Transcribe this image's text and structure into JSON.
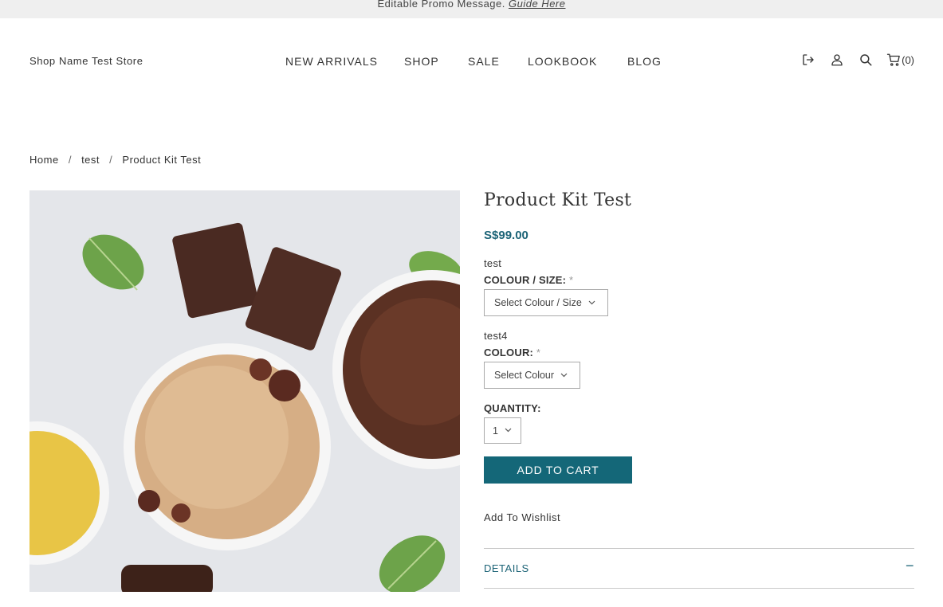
{
  "promo": {
    "text": "Editable Promo Message.",
    "link": "Guide Here"
  },
  "header": {
    "store_name": "Shop Name Test Store",
    "nav": [
      "NEW ARRIVALS",
      "SHOP",
      "SALE",
      "LOOKBOOK",
      "BLOG"
    ],
    "icons": [
      "logout-icon",
      "user-icon",
      "search-icon",
      "cart-icon"
    ],
    "cart_count": "(0)"
  },
  "breadcrumb": {
    "items": [
      "Home",
      "test",
      "Product Kit Test"
    ],
    "separator": "/"
  },
  "product": {
    "title": "Product Kit Test",
    "price": "S$99.00",
    "options": [
      {
        "name": "test",
        "label": "COLOUR / SIZE:",
        "required": "*",
        "placeholder": "Select Colour / Size"
      },
      {
        "name": "test4",
        "label": "COLOUR:",
        "required": "*",
        "placeholder": "Select Colour"
      }
    ],
    "quantity_label": "QUANTITY:",
    "quantity_value": "1",
    "add_to_cart": "ADD TO CART",
    "wishlist": "Add To Wishlist",
    "details_label": "DETAILS",
    "details_toggle": "−"
  },
  "colors": {
    "accent": "#146778",
    "price": "#1d6477",
    "promo_bg": "#efefef"
  }
}
